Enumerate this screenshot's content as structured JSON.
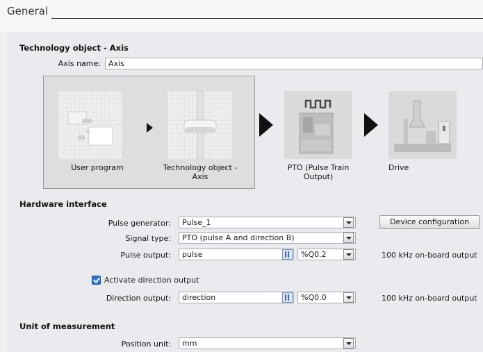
{
  "header": {
    "title": "General"
  },
  "technology_object": {
    "section_title": "Technology object - Axis",
    "axis_name_label": "Axis name:",
    "axis_name_value": "Axis"
  },
  "diagram": {
    "user_program": "User program",
    "tech_object_line1": "Technology object -",
    "tech_object_line2": "Axis",
    "pto_line1": "PTO (Pulse Train",
    "pto_line2": "Output)",
    "drive": "Drive"
  },
  "hardware": {
    "section_title": "Hardware interface",
    "pulse_generator_label": "Pulse generator:",
    "pulse_generator_value": "Pulse_1",
    "device_configuration_button": "Device configuration",
    "signal_type_label": "Signal type:",
    "signal_type_value": "PTO (pulse A and direction B)",
    "pulse_output_label": "Pulse output:",
    "pulse_output_value": "pulse",
    "pulse_output_address": "%Q0.2",
    "pulse_output_info": "100 kHz on-board output",
    "activate_direction_label": "Activate direction output",
    "activate_direction_checked": true,
    "direction_output_label": "Direction output:",
    "direction_output_value": "direction",
    "direction_output_address": "%Q0.0",
    "direction_output_info": "100 kHz on-board output"
  },
  "unit": {
    "section_title": "Unit of measurement",
    "position_unit_label": "Position unit:",
    "position_unit_value": "mm"
  },
  "colors": {
    "background": "#e9ebee",
    "checkbox_accent": "#2f74c8",
    "icon_blue": "#3a66b5"
  }
}
